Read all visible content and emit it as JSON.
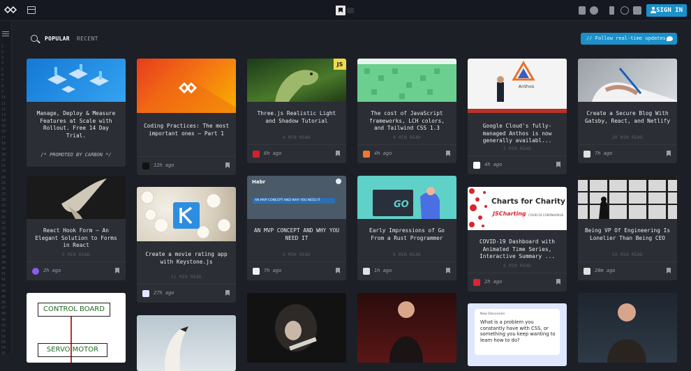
{
  "header": {
    "sign_in_label": "SIGN IN"
  },
  "filters": {
    "popular_label": "POPULAR",
    "recent_label": "RECENT",
    "follow_label": "// Follow real-time updates"
  },
  "gutter": {
    "line_numbers": [
      "1",
      "2",
      "3",
      "4",
      "5",
      "6",
      "7",
      "8",
      "9",
      "10",
      "11",
      "12",
      "13",
      "14",
      "15",
      "16",
      "17",
      "18",
      "19",
      "20",
      "21",
      "22",
      "23",
      "24",
      "25",
      "26",
      "27",
      "28",
      "29",
      "30",
      "31",
      "32",
      "33",
      "34",
      "35",
      "36",
      "37",
      "38",
      "39",
      "40",
      "41",
      "42",
      "43",
      "44",
      "45",
      "46",
      "47",
      "48",
      "49",
      "50",
      "51",
      "52",
      "53",
      "54",
      "55"
    ]
  },
  "cards": [
    {
      "title": "Manage, Deploy & Measure Features at Scale with Rollout. Free 14 Day Trial.",
      "promo": "/* PROMOTED BY CARBON */"
    },
    {
      "title": "Coding Practices: The most important ones – Part 1",
      "ago": "12h ago"
    },
    {
      "title": "Three.js Realistic Light and Shadow Tutorial",
      "read": "4 MIN READ",
      "ago": "6h ago",
      "badge": "JS"
    },
    {
      "title": "The cost of JavaScript frameworks, LCH colors, and Tailwind CSS 1.3",
      "read": "4 MIN READ",
      "ago": "4h ago"
    },
    {
      "title": "Google Cloud's fully-managed Anthos is now generally availabl...",
      "read": "3 MIN READ",
      "ago": "4h ago",
      "img_label": "Anthos"
    },
    {
      "title": "Create a Secure Blog With Gatsby, React, and Netlify",
      "read": "20 MIN READ",
      "ago": "7h ago"
    },
    {
      "title": "React Hook Form — An Elegant Solution to Forms in React",
      "read": "5 MIN READ",
      "ago": "2h ago"
    },
    {
      "title": "Create a movie rating app with Keystone.js",
      "read": "11 MIN READ",
      "ago": "27h ago"
    },
    {
      "title": "AN MVP CONCEPT AND WHY YOU NEED IT",
      "read": "5 MIN READ",
      "ago": "7h ago",
      "img_logo": "Habr",
      "img_banner": "AN MVP CONCEPT AND WHY YOU NEED IT"
    },
    {
      "title": "Early Impressions of Go From a Rust Programmer",
      "read": "8 MIN READ",
      "ago": "1h ago",
      "img_label": "GO"
    },
    {
      "title": "COVID-19 Dashboard with Animated Time Series, Interactive Summary ...",
      "read": "6 MIN READ",
      "ago": "2h ago",
      "img_title": "Charts for Charity",
      "img_brand": "JSCharting",
      "img_sub": "COVID-19 CORONAVIRUS"
    },
    {
      "title": "Being VP Of Engineering Is Lonelier Than Being CEO",
      "read": "10 MIN READ",
      "ago": "20m ago"
    },
    {
      "img_box1": "CONTROL BOARD",
      "img_box2": "SERVO MOTOR"
    },
    {},
    {},
    {},
    {
      "img_header": "New Discussion",
      "img_question": "What is a problem you constantly have with CSS, or something you keep wanting to learn how to do?"
    },
    {}
  ],
  "colors": {
    "accent": "#1b90c9",
    "background": "#1c1f26",
    "card": "#2b2e35"
  }
}
